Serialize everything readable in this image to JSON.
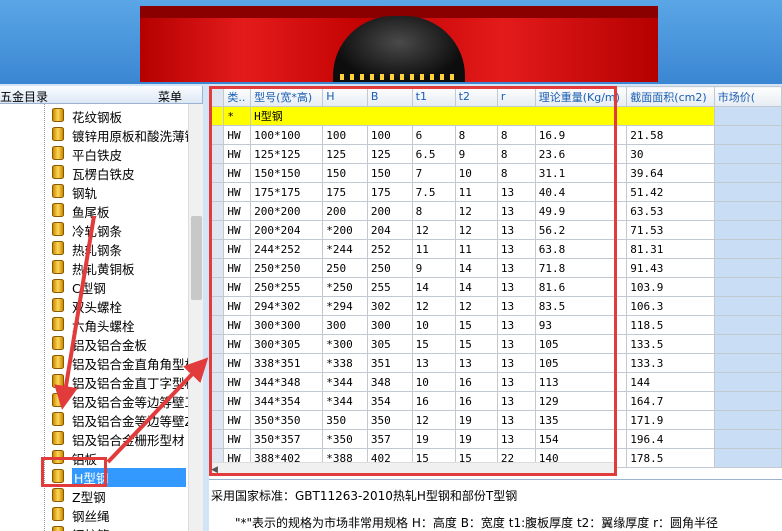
{
  "sidebar": {
    "title": "五金目录",
    "menu_label": "菜单",
    "items": [
      {
        "label": "花纹钢板"
      },
      {
        "label": "镀锌用原板和酸洗薄钢"
      },
      {
        "label": "平白铁皮"
      },
      {
        "label": "瓦楞白铁皮"
      },
      {
        "label": "钢轨"
      },
      {
        "label": "鱼尾板"
      },
      {
        "label": "冷轧钢条"
      },
      {
        "label": "热轧钢条"
      },
      {
        "label": "热轧黄铜板"
      },
      {
        "label": "C型钢"
      },
      {
        "label": "双头螺栓"
      },
      {
        "label": "六角头螺栓"
      },
      {
        "label": "铝及铝合金板"
      },
      {
        "label": "铝及铝合金直角角型材"
      },
      {
        "label": "铝及铝合金直丁字型材"
      },
      {
        "label": "铝及铝合金等边等壁工"
      },
      {
        "label": "铝及铝合金等边等壁Z"
      },
      {
        "label": "铝及铝合金栅形型材"
      },
      {
        "label": "铝板"
      },
      {
        "label": "H型钢"
      },
      {
        "label": "Z型钢"
      },
      {
        "label": "钢丝绳"
      },
      {
        "label": "钢护管"
      }
    ],
    "selected_index": 19
  },
  "grid": {
    "columns": [
      "类..",
      "型号(宽*高)",
      "H",
      "B",
      "t1",
      "t2",
      "r",
      "理论重量(Kg/m)",
      "截面面积(cm2)",
      "市场价("
    ],
    "group_row": {
      "marker": "*",
      "label": "H型钢"
    },
    "rows": [
      [
        "HW",
        "100*100",
        "100",
        "100",
        "6",
        "8",
        "8",
        "16.9",
        "21.58"
      ],
      [
        "HW",
        "125*125",
        "125",
        "125",
        "6.5",
        "9",
        "8",
        "23.6",
        "30"
      ],
      [
        "HW",
        "150*150",
        "150",
        "150",
        "7",
        "10",
        "8",
        "31.1",
        "39.64"
      ],
      [
        "HW",
        "175*175",
        "175",
        "175",
        "7.5",
        "11",
        "13",
        "40.4",
        "51.42"
      ],
      [
        "HW",
        "200*200",
        "200",
        "200",
        "8",
        "12",
        "13",
        "49.9",
        "63.53"
      ],
      [
        "HW",
        "200*204",
        "*200",
        "204",
        "12",
        "12",
        "13",
        "56.2",
        "71.53"
      ],
      [
        "HW",
        "244*252",
        "*244",
        "252",
        "11",
        "11",
        "13",
        "63.8",
        "81.31"
      ],
      [
        "HW",
        "250*250",
        "250",
        "250",
        "9",
        "14",
        "13",
        "71.8",
        "91.43"
      ],
      [
        "HW",
        "250*255",
        "*250",
        "255",
        "14",
        "14",
        "13",
        "81.6",
        "103.9"
      ],
      [
        "HW",
        "294*302",
        "*294",
        "302",
        "12",
        "12",
        "13",
        "83.5",
        "106.3"
      ],
      [
        "HW",
        "300*300",
        "300",
        "300",
        "10",
        "15",
        "13",
        "93",
        "118.5"
      ],
      [
        "HW",
        "300*305",
        "*300",
        "305",
        "15",
        "15",
        "13",
        "105",
        "133.5"
      ],
      [
        "HW",
        "338*351",
        "*338",
        "351",
        "13",
        "13",
        "13",
        "105",
        "133.3"
      ],
      [
        "HW",
        "344*348",
        "*344",
        "348",
        "10",
        "16",
        "13",
        "113",
        "144"
      ],
      [
        "HW",
        "344*354",
        "*344",
        "354",
        "16",
        "16",
        "13",
        "129",
        "164.7"
      ],
      [
        "HW",
        "350*350",
        "350",
        "350",
        "12",
        "19",
        "13",
        "135",
        "171.9"
      ],
      [
        "HW",
        "350*357",
        "*350",
        "357",
        "19",
        "19",
        "13",
        "154",
        "196.4"
      ],
      [
        "HW",
        "388*402",
        "*388",
        "402",
        "15",
        "15",
        "22",
        "140",
        "178.5"
      ]
    ]
  },
  "info": {
    "standard": "采用国家标准：GBT11263-2010热轧H型钢和部份T型钢",
    "legend": "\"*\"表示的规格为市场非常用规格  H：高度 B：宽度 t1:腹板厚度 t2：翼缘厚度 r：圆角半径"
  },
  "annotation_color": "#e23b3b",
  "selection_color": "#3399ff",
  "highlight_color": "#ffff00"
}
